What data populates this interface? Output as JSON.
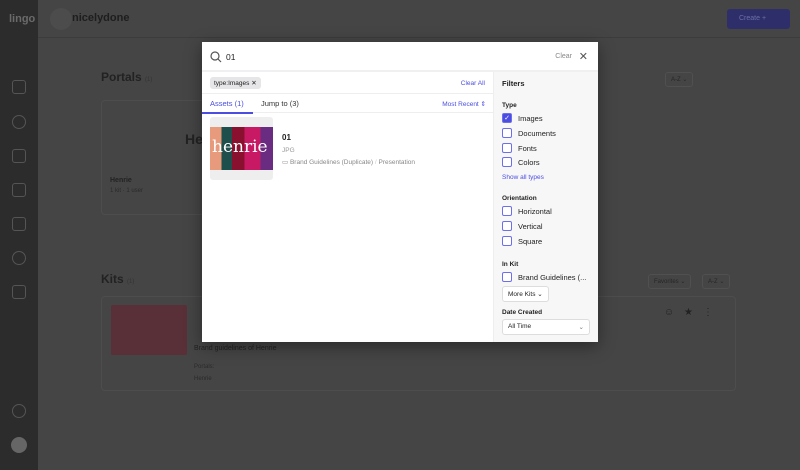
{
  "background": {
    "logo": "lingo",
    "org_name": "nicelydone",
    "create_label": "Create +",
    "portals": {
      "title": "Portals",
      "count": "(1)",
      "sort": "A-Z ⌄",
      "card_name": "Henrie",
      "card_meta": "1 kit · 1 user",
      "card_preview": "He"
    },
    "kits": {
      "title": "Kits",
      "count": "(1)",
      "filter": "Favorites ⌄",
      "sort": "A-Z ⌄",
      "description": "Brand guidelines of Henrie",
      "portals_label": "Portals:",
      "portal_tag": "Henrie"
    }
  },
  "search": {
    "query": "01",
    "clear_label": "Clear"
  },
  "filter_chip": "type:Images",
  "clear_all": "Clear All",
  "tabs": [
    {
      "label": "Assets (1)"
    },
    {
      "label": "Jump to (3)"
    }
  ],
  "sort_label": "Most Recent ⇕",
  "result": {
    "title": "01",
    "type": "JPG",
    "kit": "Brand Guidelines (Duplicate)",
    "sep": "/",
    "section": "Presentation",
    "thumb_text": "henrie"
  },
  "filters": {
    "title": "Filters",
    "type_label": "Type",
    "types": [
      {
        "label": "Images",
        "checked": true
      },
      {
        "label": "Documents"
      },
      {
        "label": "Fonts"
      },
      {
        "label": "Colors"
      }
    ],
    "show_all": "Show all types",
    "orientation_label": "Orientation",
    "orientations": [
      {
        "label": "Horizontal"
      },
      {
        "label": "Vertical"
      },
      {
        "label": "Square"
      }
    ],
    "kit_label": "In Kit",
    "kit_option": "Brand Guidelines (...",
    "more_kits": "More Kits ⌄",
    "date_label": "Date Created",
    "date_value": "All Time"
  },
  "colors": {
    "accent": "#4b4de0"
  }
}
